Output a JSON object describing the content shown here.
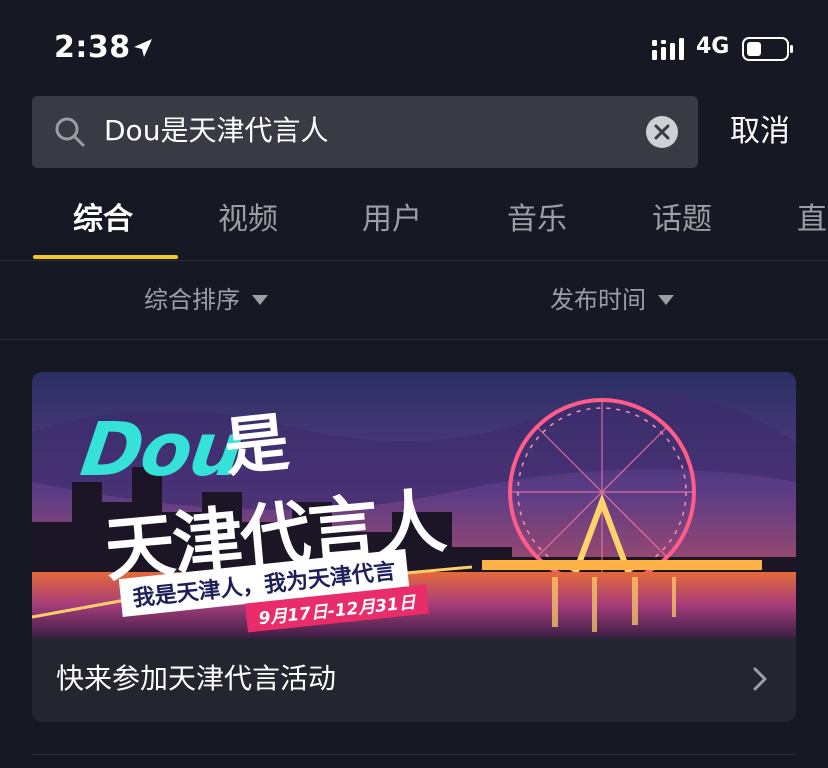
{
  "status_bar": {
    "time": "2:38",
    "network": "4G"
  },
  "search": {
    "query": "Dou是天津代言人",
    "cancel_label": "取消"
  },
  "tabs": [
    {
      "label": "综合",
      "active": true
    },
    {
      "label": "视频",
      "active": false
    },
    {
      "label": "用户",
      "active": false
    },
    {
      "label": "音乐",
      "active": false
    },
    {
      "label": "话题",
      "active": false
    },
    {
      "label": "直",
      "active": false
    }
  ],
  "filters": {
    "sort_label": "综合排序",
    "time_label": "发布时间"
  },
  "card": {
    "banner": {
      "brand": "Dou",
      "title_line1": "是",
      "title_line2": "天津代言人",
      "slogan": "我是天津人，我为天津代言",
      "dates": "9月17日-12月31日"
    },
    "title": "快来参加天津代言活动"
  },
  "colors": {
    "background": "#161823",
    "accent": "#f5c722",
    "search_bg": "#393b44",
    "card_bg": "#23252f"
  }
}
